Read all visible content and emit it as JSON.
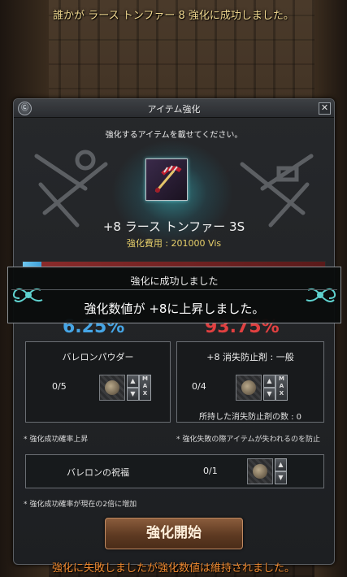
{
  "system_messages": {
    "top": "誰かが ラース トンファー 8 強化に成功しました。",
    "bottom": "強化に失敗しましたが強化数値は維持されました。"
  },
  "window": {
    "title": "アイテム強化",
    "icon": "emblem-icon",
    "close_icon": "close-icon",
    "close_glyph": "✕"
  },
  "enhance": {
    "instruction": "強化するアイテムを載せてください。",
    "item_name": "+8 ラース トンファー 3S",
    "cost_label": "強化費用 : 201000 Vis",
    "success_rate": "6.25%",
    "fail_rate": "93.75%",
    "success_fraction": 0.0625
  },
  "popup": {
    "title": "強化に成功しました",
    "message": "強化数値が +8に上昇しました。"
  },
  "materials": {
    "barrelon_powder": {
      "title": "バレロンパウダー",
      "count": "0/5",
      "note": "* 強化成功確率上昇"
    },
    "protection": {
      "title": "+8 消失防止剤 : 一般",
      "count": "0/4",
      "owned": "所持した消失防止剤の数 : 0",
      "note": "* 強化失敗の際アイテムが失われるのを防止"
    },
    "blessing": {
      "title": "バレロンの祝福",
      "count": "0/1",
      "note": "* 強化成功確率が現在の2倍に増加"
    },
    "spinner": {
      "up": "▲",
      "down": "▼",
      "max": [
        "M",
        "A",
        "X"
      ]
    }
  },
  "start_button": "強化開始",
  "colors": {
    "success": "#46a6e6",
    "fail": "#e14040",
    "cost": "#e7cf6a",
    "system_top": "#f0d890",
    "system_bottom": "#f08a30"
  }
}
